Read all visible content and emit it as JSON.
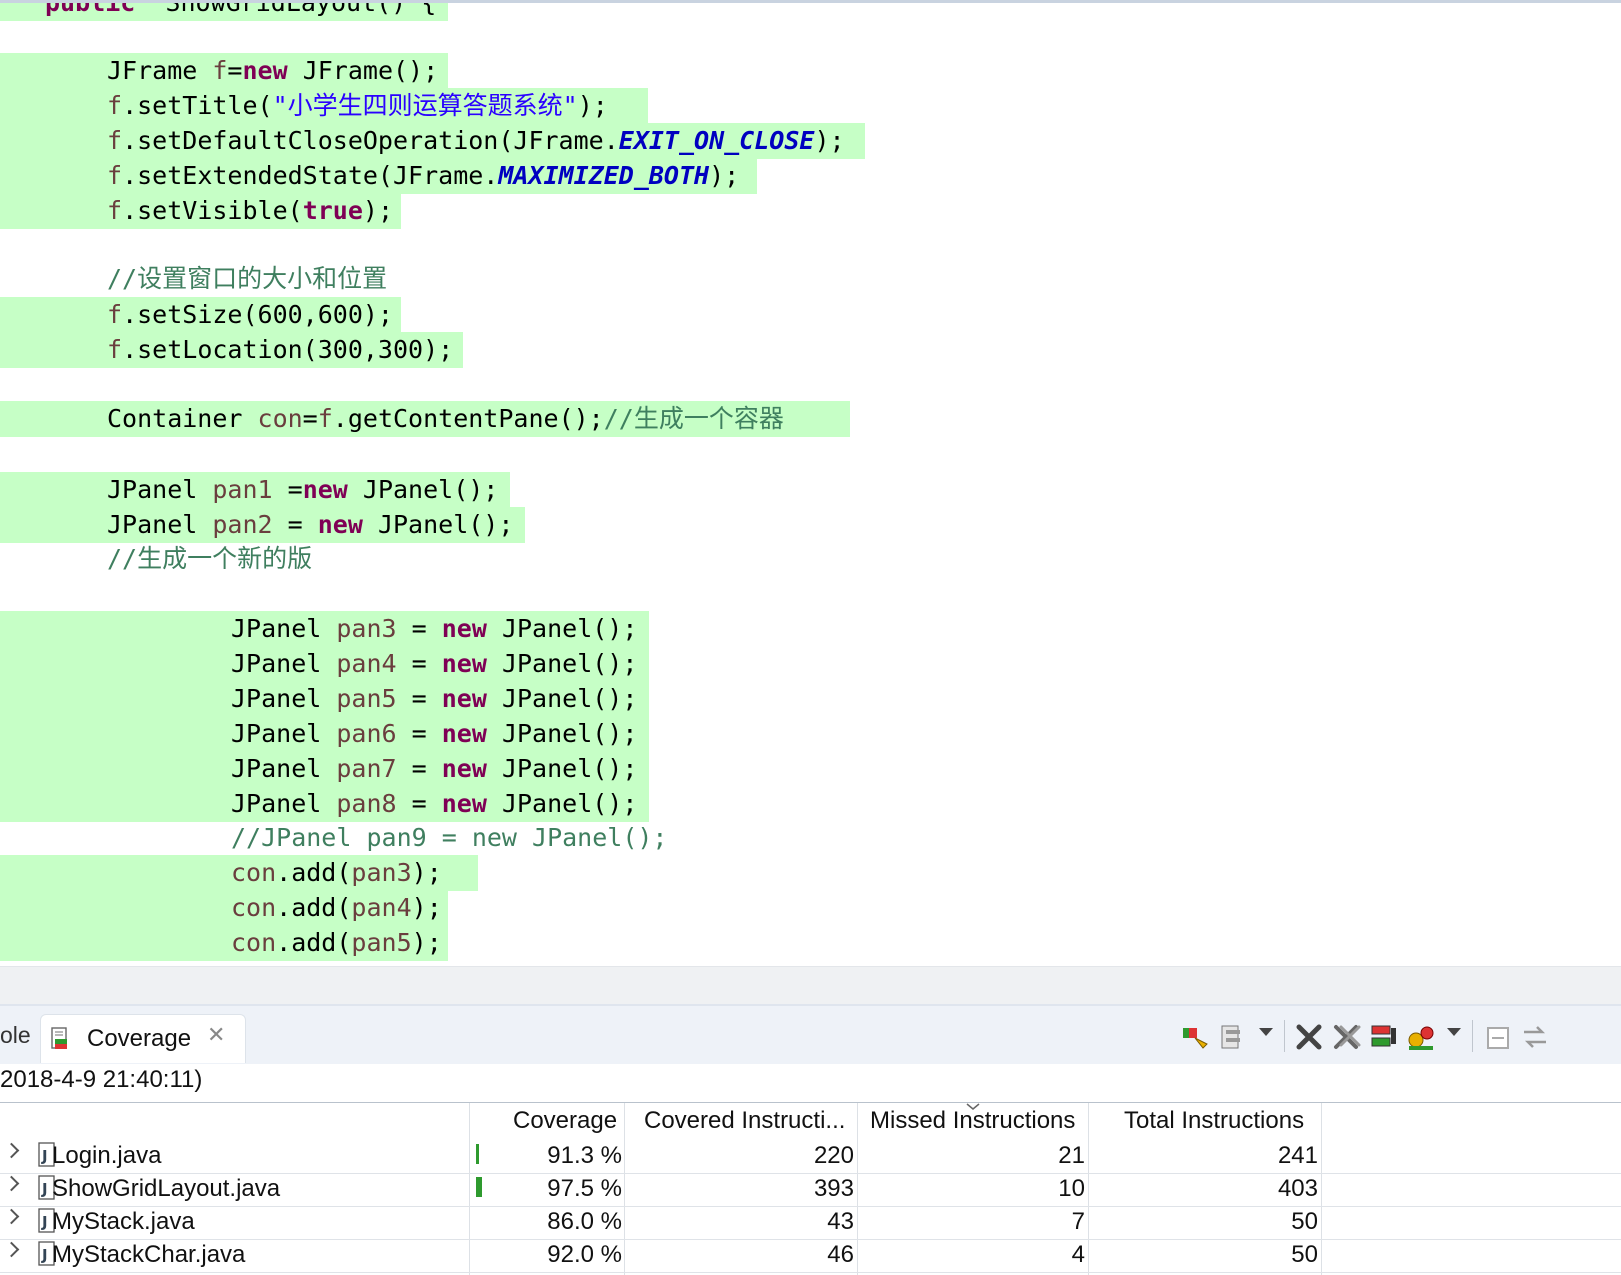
{
  "editor": {
    "lines": [
      {
        "segs": [
          [
            "kw",
            "public"
          ],
          [
            "t",
            "  ShowGridLayout() {"
          ]
        ]
      },
      {
        "segs": [
          [
            "t",
            "JFrame "
          ],
          [
            "var",
            "f"
          ],
          [
            "t",
            "="
          ],
          [
            "kw",
            "new"
          ],
          [
            "t",
            " JFrame();"
          ]
        ]
      },
      {
        "segs": [
          [
            "var",
            "f"
          ],
          [
            "t",
            ".setTitle("
          ],
          [
            "str",
            "\"小学生四则运算答题系统\""
          ],
          [
            "t",
            ");"
          ]
        ]
      },
      {
        "segs": [
          [
            "var",
            "f"
          ],
          [
            "t",
            ".setDefaultCloseOperation(JFrame."
          ],
          [
            "cst",
            "EXIT_ON_CLOSE"
          ],
          [
            "t",
            ");"
          ]
        ]
      },
      {
        "segs": [
          [
            "var",
            "f"
          ],
          [
            "t",
            ".setExtendedState(JFrame."
          ],
          [
            "cst",
            "MAXIMIZED_BOTH"
          ],
          [
            "t",
            ");"
          ]
        ]
      },
      {
        "segs": [
          [
            "var",
            "f"
          ],
          [
            "t",
            ".setVisible("
          ],
          [
            "kw",
            "true"
          ],
          [
            "t",
            ");"
          ]
        ]
      },
      {
        "segs": [
          [
            "cmt",
            "//设置窗口的大小和位置"
          ]
        ]
      },
      {
        "segs": [
          [
            "var",
            "f"
          ],
          [
            "t",
            ".setSize(600,600);"
          ]
        ]
      },
      {
        "segs": [
          [
            "var",
            "f"
          ],
          [
            "t",
            ".setLocation(300,300);"
          ]
        ]
      },
      {
        "segs": [
          [
            "t",
            "Container "
          ],
          [
            "var",
            "con"
          ],
          [
            "t",
            "="
          ],
          [
            "var",
            "f"
          ],
          [
            "t",
            ".getContentPane();"
          ],
          [
            "cmt",
            "//生成一个容器"
          ]
        ]
      },
      {
        "segs": [
          [
            "t",
            "JPanel "
          ],
          [
            "var",
            "pan1"
          ],
          [
            "t",
            " ="
          ],
          [
            "kw",
            "new"
          ],
          [
            "t",
            " JPanel();"
          ]
        ]
      },
      {
        "segs": [
          [
            "t",
            "JPanel "
          ],
          [
            "var",
            "pan2"
          ],
          [
            "t",
            " = "
          ],
          [
            "kw",
            "new"
          ],
          [
            "t",
            " JPanel();"
          ]
        ]
      },
      {
        "segs": [
          [
            "cmt",
            "//生成一个新的版"
          ]
        ]
      },
      {
        "segs": [
          [
            "t",
            "JPanel "
          ],
          [
            "var",
            "pan3"
          ],
          [
            "t",
            " = "
          ],
          [
            "kw",
            "new"
          ],
          [
            "t",
            " JPanel();"
          ]
        ]
      },
      {
        "segs": [
          [
            "t",
            "JPanel "
          ],
          [
            "var",
            "pan4"
          ],
          [
            "t",
            " = "
          ],
          [
            "kw",
            "new"
          ],
          [
            "t",
            " JPanel();"
          ]
        ]
      },
      {
        "segs": [
          [
            "t",
            "JPanel "
          ],
          [
            "var",
            "pan5"
          ],
          [
            "t",
            " = "
          ],
          [
            "kw",
            "new"
          ],
          [
            "t",
            " JPanel();"
          ]
        ]
      },
      {
        "segs": [
          [
            "t",
            "JPanel "
          ],
          [
            "var",
            "pan6"
          ],
          [
            "t",
            " = "
          ],
          [
            "kw",
            "new"
          ],
          [
            "t",
            " JPanel();"
          ]
        ]
      },
      {
        "segs": [
          [
            "t",
            "JPanel "
          ],
          [
            "var",
            "pan7"
          ],
          [
            "t",
            " = "
          ],
          [
            "kw",
            "new"
          ],
          [
            "t",
            " JPanel();"
          ]
        ]
      },
      {
        "segs": [
          [
            "t",
            "JPanel "
          ],
          [
            "var",
            "pan8"
          ],
          [
            "t",
            " = "
          ],
          [
            "kw",
            "new"
          ],
          [
            "t",
            " JPanel();"
          ]
        ]
      },
      {
        "segs": [
          [
            "cmt",
            "//JPanel pan9 = new JPanel();"
          ]
        ]
      },
      {
        "segs": [
          [
            "var",
            "con"
          ],
          [
            "t",
            ".add("
          ],
          [
            "var",
            "pan3"
          ],
          [
            "t",
            ");"
          ]
        ]
      },
      {
        "segs": [
          [
            "var",
            "con"
          ],
          [
            "t",
            ".add("
          ],
          [
            "var",
            "pan4"
          ],
          [
            "t",
            ");"
          ]
        ]
      },
      {
        "segs": [
          [
            "var",
            "con"
          ],
          [
            "t",
            ".add("
          ],
          [
            "var",
            "pan5"
          ],
          [
            "t",
            ");"
          ]
        ]
      }
    ],
    "colors": {
      "covered_bg": "#c6ffc6",
      "keyword": "#7f0055",
      "string": "#2a00ff",
      "constant": "#0000c0",
      "comment": "#3f7f5f"
    }
  },
  "view": {
    "prev_tab_fragment": "ole",
    "tab_label": "Coverage",
    "session": "2018-4-9 21:40:11)",
    "columns": {
      "coverage": "Coverage",
      "covered": "Covered Instructi...",
      "missed": "Missed Instructions",
      "total": "Total Instructions"
    },
    "rows": [
      {
        "name": "Login.java",
        "coverage": "91.3 %",
        "covered": "220",
        "missed": "21",
        "total": "241"
      },
      {
        "name": "ShowGridLayout.java",
        "coverage": "97.5 %",
        "covered": "393",
        "missed": "10",
        "total": "403"
      },
      {
        "name": "MyStack.java",
        "coverage": "86.0 %",
        "covered": "43",
        "missed": "7",
        "total": "50"
      },
      {
        "name": "MyStackChar.java",
        "coverage": "92.0 %",
        "covered": "46",
        "missed": "4",
        "total": "50"
      }
    ]
  }
}
